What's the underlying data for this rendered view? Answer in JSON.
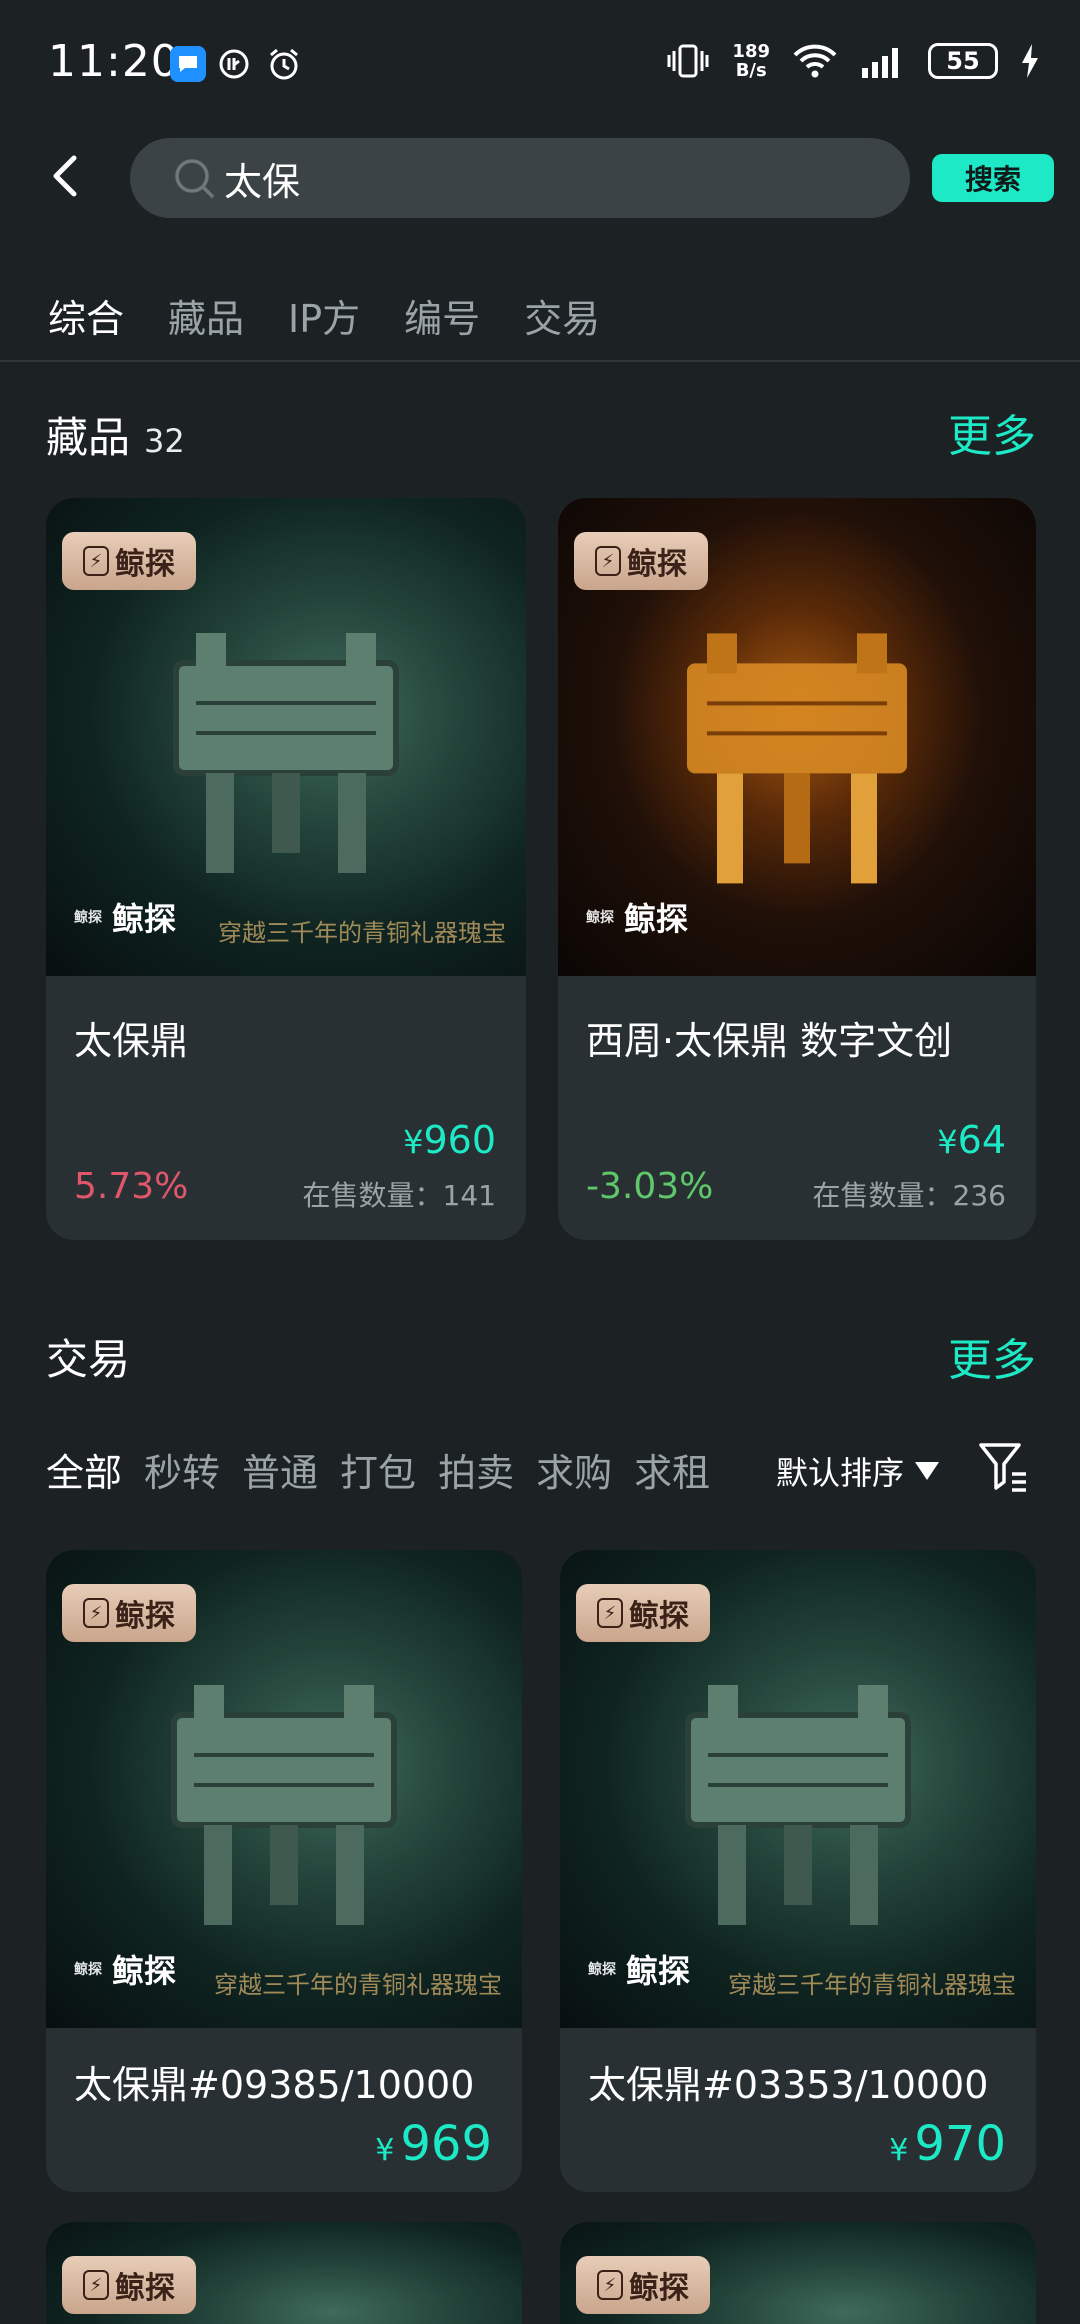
{
  "status_bar": {
    "time": "11:20",
    "net_speed_value": "189",
    "net_speed_unit": "B/s",
    "battery": "55"
  },
  "search": {
    "query": "太保",
    "button_label": "搜索"
  },
  "tabs": [
    {
      "label": "综合",
      "active": true
    },
    {
      "label": "藏品",
      "active": false
    },
    {
      "label": "IP方",
      "active": false
    },
    {
      "label": "编号",
      "active": false
    },
    {
      "label": "交易",
      "active": false
    }
  ],
  "collections": {
    "title": "藏品",
    "count": "32",
    "more_label": "更多",
    "items": [
      {
        "brand": "鲸探",
        "watermark": "鲸探",
        "name": "太保鼎",
        "price_symbol": "¥",
        "price": "960",
        "change": "5.73%",
        "stock_label": "在售数量：",
        "stock": "141"
      },
      {
        "brand": "鲸探",
        "watermark": "鲸探",
        "name": "西周·太保鼎 数字文创",
        "price_symbol": "¥",
        "price": "64",
        "change": "-3.03%",
        "stock_label": "在售数量：",
        "stock": "236"
      }
    ]
  },
  "trades": {
    "title": "交易",
    "more_label": "更多",
    "filters": [
      {
        "label": "全部",
        "active": true
      },
      {
        "label": "秒转",
        "active": false
      },
      {
        "label": "普通",
        "active": false
      },
      {
        "label": "打包",
        "active": false
      },
      {
        "label": "拍卖",
        "active": false
      },
      {
        "label": "求购",
        "active": false
      },
      {
        "label": "求租",
        "active": false
      }
    ],
    "sort_label": "默认排序",
    "items": [
      {
        "brand": "鲸探",
        "watermark": "鲸探",
        "name": "太保鼎#09385/10000",
        "price_symbol": "¥",
        "price": "969"
      },
      {
        "brand": "鲸探",
        "watermark": "鲸探",
        "name": "太保鼎#03353/10000",
        "price_symbol": "¥",
        "price": "970"
      },
      {
        "brand": "鲸探"
      },
      {
        "brand": "鲸探"
      }
    ]
  },
  "colors": {
    "accent": "#1de9c6",
    "up": "#e0566a",
    "down": "#5fc86a",
    "background": "#1c2224",
    "card": "#283033"
  }
}
